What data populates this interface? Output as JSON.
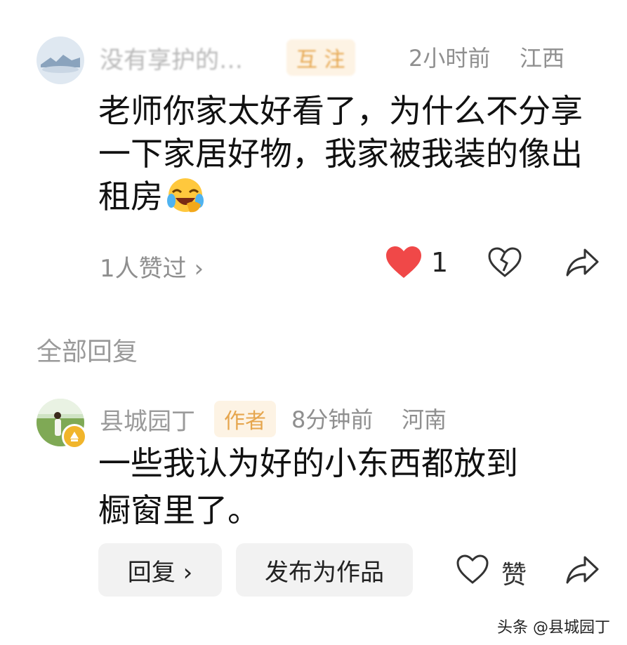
{
  "comment": {
    "username": "没有享护的…",
    "tag_label": "互 注",
    "time": "2小时前",
    "location": "江西",
    "text": "老师你家太好看了，为什么不分享一下家居好物，我家被我装的像出租房",
    "emoji": "grinning-squinting-tears-emoji",
    "likes_summary": "1人赞过 ›",
    "like_count": "1",
    "colors": {
      "heart": "#f04848",
      "tag_bg": "#fdf3e4",
      "tag_text": "#e6a64e"
    }
  },
  "section_title": "全部回复",
  "reply": {
    "username": "县城园丁",
    "tag_label": "作者",
    "time": "8分钟前",
    "location": "河南",
    "text_line1": "一些我认为好的小东西都放到",
    "text_line2": "橱窗里了。",
    "reply_button": "回复 ›",
    "publish_button": "发布为作品",
    "like_label": "赞"
  },
  "watermark": "头条 @县城园丁"
}
